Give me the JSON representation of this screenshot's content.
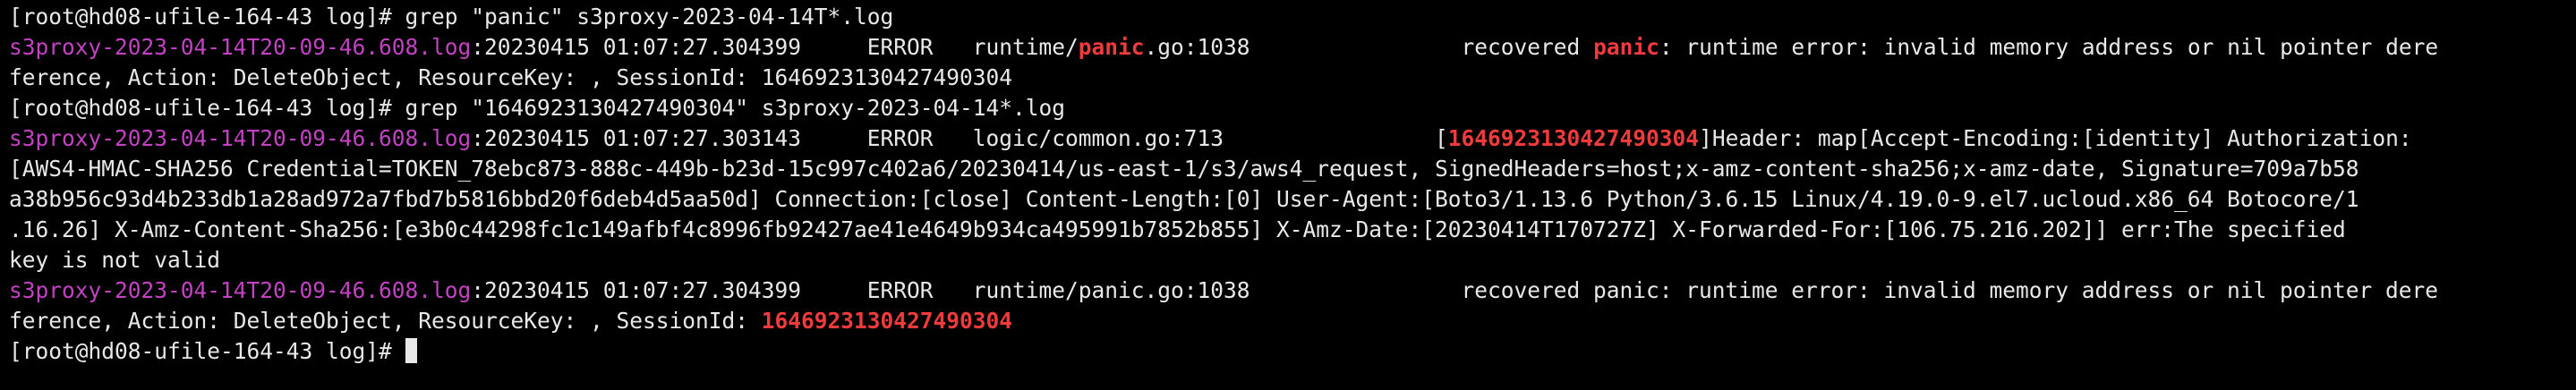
{
  "terminal": {
    "prompt": "[root@hd08-ufile-164-43 log]# ",
    "cmd1": "grep \"panic\" s3proxy-2023-04-14T*.log",
    "cmd2": "grep \"1646923130427490304\" s3proxy-2023-04-14*.log",
    "r1_file": "s3proxy-2023-04-14T20-09-46.608.log",
    "r1_pre": ":20230415 01:07:27.304399     ERROR   runtime/",
    "r1_hl1": "panic",
    "r1_mid": ".go:1038                recovered ",
    "r1_hl2": "panic",
    "r1_post": ": runtime error: invalid memory address or nil pointer dere",
    "r1_cont": "ference, Action: DeleteObject, ResourceKey: , SessionId: 1646923130427490304",
    "r2_file": "s3proxy-2023-04-14T20-09-46.608.log",
    "r2_pre": ":20230415 01:07:27.303143     ERROR   logic/common.go:713                [",
    "r2_hl": "1646923130427490304",
    "r2_post": "]Header: map[Accept-Encoding:[identity] Authorization:",
    "r2_l2": "[AWS4-HMAC-SHA256 Credential=TOKEN_78ebc873-888c-449b-b23d-15c997c402a6/20230414/us-east-1/s3/aws4_request, SignedHeaders=host;x-amz-content-sha256;x-amz-date, Signature=709a7b58",
    "r2_l3": "a38b956c93d4b233db1a28ad972a7fbd7b5816bbd20f6deb4d5aa50d] Connection:[close] Content-Length:[0] User-Agent:[Boto3/1.13.6 Python/3.6.15 Linux/4.19.0-9.el7.ucloud.x86_64 Botocore/1",
    "r2_l4": ".16.26] X-Amz-Content-Sha256:[e3b0c44298fc1c149afbf4c8996fb92427ae41e4649b934ca495991b7852b855] X-Amz-Date:[20230414T170727Z] X-Forwarded-For:[106.75.216.202]] err:The specified",
    "r2_l5": "key is not valid",
    "r3_file": "s3proxy-2023-04-14T20-09-46.608.log",
    "r3_pre": ":20230415 01:07:27.304399     ERROR   runtime/panic.go:1038                recovered panic: runtime error: invalid memory address or nil pointer dere",
    "r3_cont_pre": "ference, Action: DeleteObject, ResourceKey: , SessionId: ",
    "r3_hl": "1646923130427490304",
    "colors": {
      "background": "#000000",
      "text": "#e8e8e8",
      "filename": "#c242c2",
      "match_highlight": "#ef3b3b"
    }
  }
}
